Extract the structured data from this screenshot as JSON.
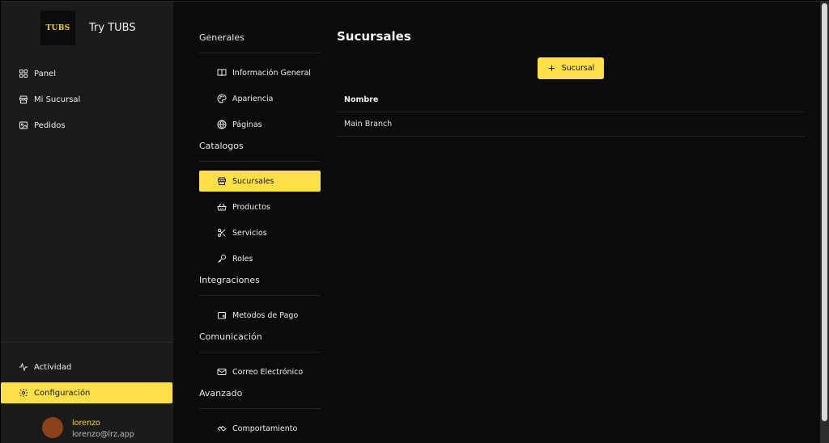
{
  "brand": {
    "logo_text": "TUBS",
    "name": "Try TUBS"
  },
  "sidebar": {
    "top_items": [
      {
        "label": "Panel",
        "icon": "layout-grid-icon"
      },
      {
        "label": "Mi Sucursal",
        "icon": "store-icon"
      },
      {
        "label": "Pedidos",
        "icon": "image-icon"
      }
    ],
    "bottom_items": [
      {
        "label": "Actividad",
        "icon": "activity-icon"
      },
      {
        "label": "Configuración",
        "icon": "gear-icon",
        "active": true
      }
    ],
    "user": {
      "name": "lorenzo",
      "email": "lorenzo@lrz.app",
      "avatar_color": "#8a4319"
    }
  },
  "settings": {
    "sections": [
      {
        "title": "Generales",
        "items": [
          {
            "label": "Información General",
            "icon": "book-open-icon"
          },
          {
            "label": "Apariencia",
            "icon": "palette-icon"
          },
          {
            "label": "Páginas",
            "icon": "globe-icon"
          }
        ]
      },
      {
        "title": "Catalogos",
        "items": [
          {
            "label": "Sucursales",
            "icon": "store-icon",
            "active": true
          },
          {
            "label": "Productos",
            "icon": "basket-icon"
          },
          {
            "label": "Servicios",
            "icon": "scissors-icon"
          },
          {
            "label": "Roles",
            "icon": "key-icon"
          }
        ]
      },
      {
        "title": "Integraciones",
        "items": [
          {
            "label": "Metodos de Pago",
            "icon": "wallet-icon"
          }
        ]
      },
      {
        "title": "Comunicación",
        "items": [
          {
            "label": "Correo Electrónico",
            "icon": "mail-icon"
          }
        ]
      },
      {
        "title": "Avanzado",
        "items": [
          {
            "label": "Comportamiento",
            "icon": "handshake-icon"
          }
        ]
      }
    ]
  },
  "main": {
    "title": "Sucursales",
    "add_button": "Sucursal",
    "table": {
      "columns": [
        "Nombre"
      ],
      "rows": [
        [
          "Main Branch"
        ]
      ]
    }
  },
  "colors": {
    "accent": "#fde047",
    "background": "#0b0b0c",
    "sidebar": "#1b1b1c"
  }
}
